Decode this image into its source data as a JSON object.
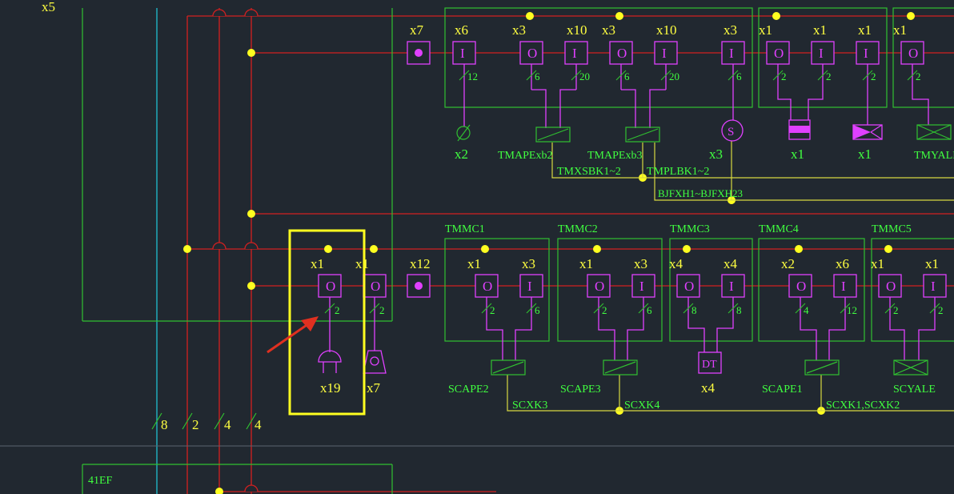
{
  "colors": {
    "background": "#212830",
    "red_line": "#d42020",
    "green_line": "#30c030",
    "magenta": "#e040ff",
    "yellow": "#ffff20",
    "cyan": "#20c0d0",
    "highlight_box": "#ffff20",
    "arrow": "#e03020"
  },
  "top_left_label": "x5",
  "top_row": {
    "io_counts": [
      "x7",
      "x6",
      "x3",
      "x10",
      "x3",
      "x10",
      "x3",
      "x1",
      "x1",
      "x1",
      "x1"
    ],
    "io_boxes": [
      "I",
      "O",
      "I",
      "O",
      "I",
      "I",
      "O",
      "I",
      "I",
      "O"
    ],
    "wire_counts": [
      "12",
      "6",
      "20",
      "6",
      "20",
      "6",
      "2",
      "2",
      "2",
      "2"
    ],
    "device_labels": [
      "x2",
      "TMAPExb2",
      "TMAPExb3",
      "x3",
      "x1",
      "x1",
      "TMYALE"
    ],
    "symbol_s": "S",
    "bus_labels": [
      "TMXSBK1~2",
      "TMPLBK1~2",
      "BJFXH1~BJFXH23"
    ]
  },
  "bottom_row": {
    "group_titles": [
      "TMMC1",
      "TMMC2",
      "TMMC3",
      "TMMC4",
      "TMMC5"
    ],
    "io_counts": [
      "x1",
      "x1",
      "x12",
      "x1",
      "x3",
      "x1",
      "x3",
      "x4",
      "x4",
      "x2",
      "x6",
      "x1",
      "x1"
    ],
    "io_boxes": [
      "O",
      "O",
      "O",
      "I",
      "O",
      "I",
      "O",
      "I",
      "O",
      "I",
      "O",
      "I"
    ],
    "wire_counts": [
      "2",
      "2",
      "2",
      "6",
      "2",
      "6",
      "8",
      "8",
      "4",
      "12",
      "2",
      "2"
    ],
    "device_labels": [
      "x19",
      "x7",
      "SCAPE2",
      "SCAPE3",
      "x4",
      "SCAPE1",
      "SCYALE"
    ],
    "dt_label": "DT",
    "bus_labels": [
      "SCXK3",
      "SCXK4",
      "SCXK1,SCXK2"
    ]
  },
  "left_wire_counts": [
    "8",
    "2",
    "4",
    "4"
  ],
  "lower_panel_label": "41EF"
}
